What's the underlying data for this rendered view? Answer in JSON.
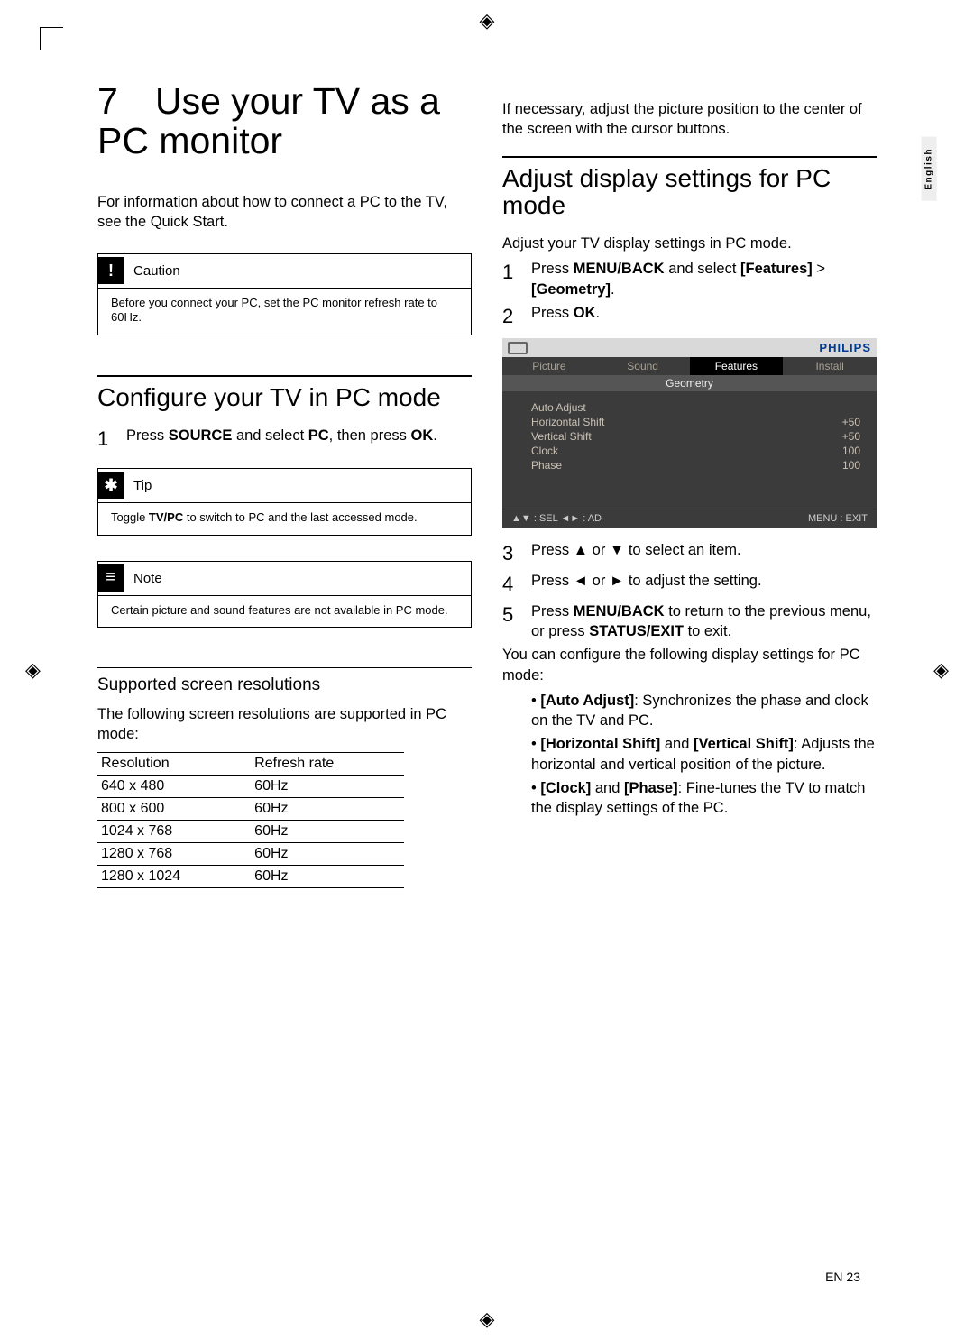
{
  "lang_tab": "English",
  "title_num": "7",
  "title_text": "Use your TV as a PC monitor",
  "intro": "For information about how to connect a PC to the TV, see the Quick Start.",
  "caution": {
    "label": "Caution",
    "body": "Before you connect your PC, set the PC monitor refresh rate to 60Hz."
  },
  "configure": {
    "heading": "Conﬁgure your TV in PC mode",
    "step1_a": "Press ",
    "step1_b": "SOURCE",
    "step1_c": " and select ",
    "step1_d": "PC",
    "step1_e": ", then press ",
    "step1_f": "OK",
    "step1_g": "."
  },
  "tip": {
    "label": "Tip",
    "body_a": "Toggle ",
    "body_b": "TV/PC",
    "body_c": " to switch to PC and the last accessed mode."
  },
  "note": {
    "label": "Note",
    "body": "Certain picture and sound features are not available in PC mode."
  },
  "resolutions": {
    "heading": "Supported screen resolutions",
    "intro": "The following screen resolutions are supported in PC mode:",
    "col1": "Resolution",
    "col2": "Refresh rate",
    "rows": [
      {
        "r": "640 x 480",
        "hz": "60Hz"
      },
      {
        "r": "800 x 600",
        "hz": "60Hz"
      },
      {
        "r": "1024 x 768",
        "hz": "60Hz"
      },
      {
        "r": "1280 x 768",
        "hz": "60Hz"
      },
      {
        "r": "1280 x 1024",
        "hz": "60Hz"
      }
    ]
  },
  "right_intro": "If necessary, adjust the picture position to the center of the screen with the cursor buttons.",
  "adjust": {
    "heading": "Adjust display settings for PC mode",
    "lead": "Adjust your TV display settings in PC mode.",
    "s1_a": "Press ",
    "s1_b": "MENU/BACK",
    "s1_c": " and select ",
    "s1_d": "[Features]",
    "s1_e": " > ",
    "s1_f": "[Geometry]",
    "s1_g": ".",
    "s2_a": "Press ",
    "s2_b": "OK",
    "s2_c": ".",
    "s3": "Press ▲ or ▼ to select an item.",
    "s4": "Press ◄ or ► to adjust the setting.",
    "s5_a": "Press ",
    "s5_b": "MENU/BACK",
    "s5_c": " to return to the previous menu, or press ",
    "s5_d": "STATUS/EXIT",
    "s5_e": " to exit.",
    "after": "You can conﬁgure the following display settings for PC mode:",
    "b1_a": "[Auto Adjust]",
    "b1_b": ": Synchronizes the phase and clock on the TV and PC.",
    "b2_a": "[Horizontal Shift]",
    "b2_b": " and ",
    "b2_c": "[Vertical Shift]",
    "b2_d": ": Adjusts the horizontal and vertical position of the picture.",
    "b3_a": "[Clock]",
    "b3_b": " and ",
    "b3_c": "[Phase]",
    "b3_d": ": Fine-tunes the TV to match the display settings of the PC."
  },
  "menu": {
    "brand": "PHILIPS",
    "tabs": [
      "Picture",
      "Sound",
      "Features",
      "Install"
    ],
    "active_tab": 2,
    "sub": "Geometry",
    "rows": [
      {
        "k": "Auto Adjust",
        "v": ""
      },
      {
        "k": "Horizontal Shift",
        "v": "+50"
      },
      {
        "k": "Vertical Shift",
        "v": "+50"
      },
      {
        "k": "Clock",
        "v": "100"
      },
      {
        "k": "Phase",
        "v": "100"
      }
    ],
    "foot_left": "▲▼ : SEL   ◄► : AD",
    "foot_right": "MENU : EXIT"
  },
  "footer": "EN    23"
}
